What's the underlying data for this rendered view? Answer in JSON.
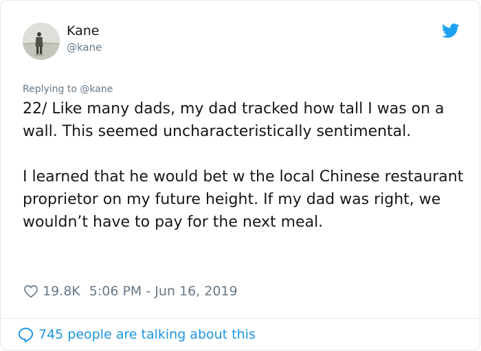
{
  "author": {
    "name": "Kane",
    "handle": "@kane"
  },
  "reply": {
    "prefix": "Replying to ",
    "mention": "@kane"
  },
  "tweet": {
    "paragraphs": [
      "22/ Like many dads, my dad tracked how tall I was on a wall. This seemed uncharacteristically sentimental.",
      "I learned that he would bet w the local Chinese restaurant proprietor on my future height. If my dad was right, we wouldn’t have to pay for the next meal."
    ]
  },
  "meta": {
    "likes": "19.8K",
    "timestamp": "5:06 PM - Jun 16, 2019"
  },
  "footer": {
    "talking_label": "745 people are talking about this"
  },
  "icons": {
    "brand": "twitter-bird-icon",
    "like": "heart-icon",
    "conversation": "speech-bubble-icon"
  },
  "colors": {
    "brand_blue": "#1da1f2",
    "link_blue": "#1b95e0",
    "muted_text": "#657786",
    "text": "#14171a",
    "border": "#e1e8ed"
  }
}
